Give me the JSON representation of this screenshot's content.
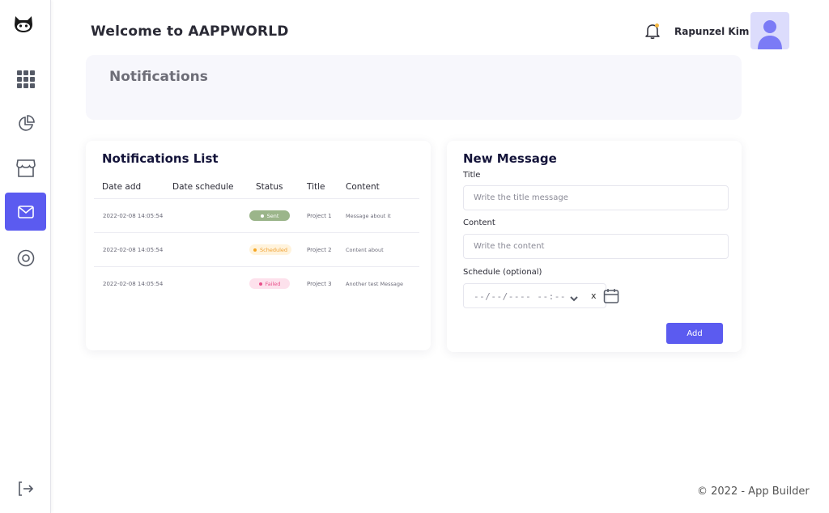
{
  "header": {
    "title": "Welcome to AAPPWORLD",
    "user_name": "Rapunzel Kim"
  },
  "sidebar": {
    "items": [
      {
        "icon": "apps-grid-icon"
      },
      {
        "icon": "pie-chart-icon"
      },
      {
        "icon": "store-icon"
      },
      {
        "icon": "mail-icon",
        "active": true
      },
      {
        "icon": "settings-circle-icon"
      }
    ],
    "logout_icon": "logout-icon"
  },
  "banner": {
    "title": "Notifications"
  },
  "notifications_list": {
    "title": "Notifications List",
    "columns": [
      "Date add",
      "Date schedule",
      "Status",
      "Title",
      "Content"
    ],
    "rows": [
      {
        "date_add": "2022-02-08 14:05:54",
        "date_schedule": "",
        "status": "Sent",
        "title": "Project 1",
        "content": "Message about it"
      },
      {
        "date_add": "2022-02-08 14:05:54",
        "date_schedule": "",
        "status": "Scheduled",
        "title": "Project 2",
        "content": "Content about"
      },
      {
        "date_add": "2022-02-08 14:05:54",
        "date_schedule": "",
        "status": "Failed",
        "title": "Project 3",
        "content": "Another  test Message"
      }
    ]
  },
  "new_message": {
    "title": "New Message",
    "title_label": "Title",
    "title_placeholder": "Write the title message",
    "content_label": "Content",
    "content_placeholder": "Write the content",
    "schedule_label": "Schedule (optional)",
    "schedule_placeholder": "--/--/---- --:--",
    "clear_label": "x",
    "add_label": "Add"
  },
  "footer": {
    "text": "© 2022 - App Builder"
  },
  "colors": {
    "accent": "#5b5bf0",
    "sent_bg": "#9bb58a",
    "scheduled_bg": "#fff3dc",
    "failed_bg": "#fde1ec"
  }
}
